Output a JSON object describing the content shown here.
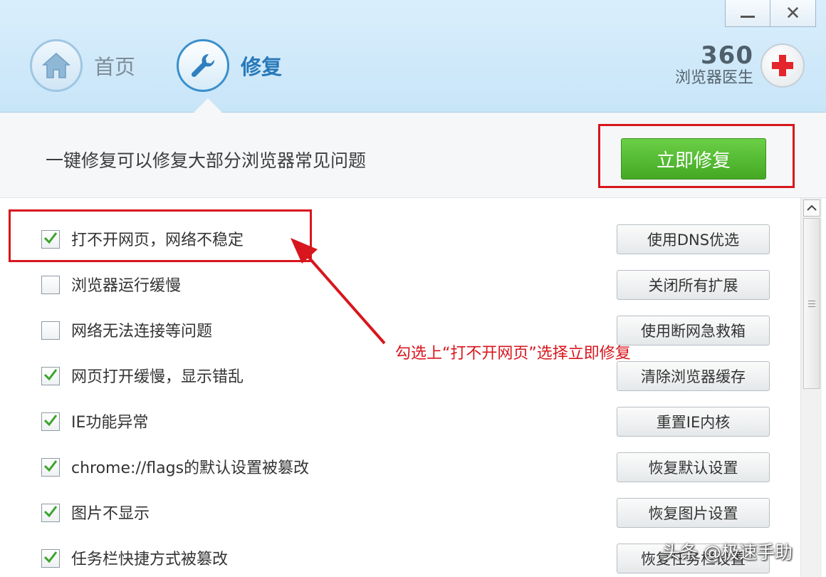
{
  "window": {
    "minimize_icon": "minimize-icon",
    "close_icon": "close-icon",
    "close_glyph": "✕"
  },
  "nav": {
    "home_label": "首页",
    "repair_label": "修复",
    "active": "repair"
  },
  "brand": {
    "number": "360",
    "name": "浏览器医生"
  },
  "header_message": "一键修复可以修复大部分浏览器常见问题",
  "fix_button_label": "立即修复",
  "colors": {
    "accent": "#2778b8",
    "fix_green": "#4caf2a",
    "annotation_red": "#d8161d"
  },
  "items": [
    {
      "label": "打不开网页，网络不稳定",
      "checked": true,
      "button": "使用DNS优选"
    },
    {
      "label": "浏览器运行缓慢",
      "checked": false,
      "button": "关闭所有扩展"
    },
    {
      "label": "网络无法连接等问题",
      "checked": false,
      "button": "使用断网急救箱"
    },
    {
      "label": "网页打开缓慢，显示错乱",
      "checked": true,
      "button": "清除浏览器缓存"
    },
    {
      "label": "IE功能异常",
      "checked": true,
      "button": "重置IE内核"
    },
    {
      "label": "chrome://flags的默认设置被篡改",
      "checked": true,
      "button": "恢复默认设置"
    },
    {
      "label": "图片不显示",
      "checked": true,
      "button": "恢复图片设置"
    },
    {
      "label": "任务栏快捷方式被篡改",
      "checked": true,
      "button": "恢复任务栏设置"
    }
  ],
  "annotation_text": "勾选上“打不开网页”选择立即修复",
  "watermark": "头条 @极速手助"
}
